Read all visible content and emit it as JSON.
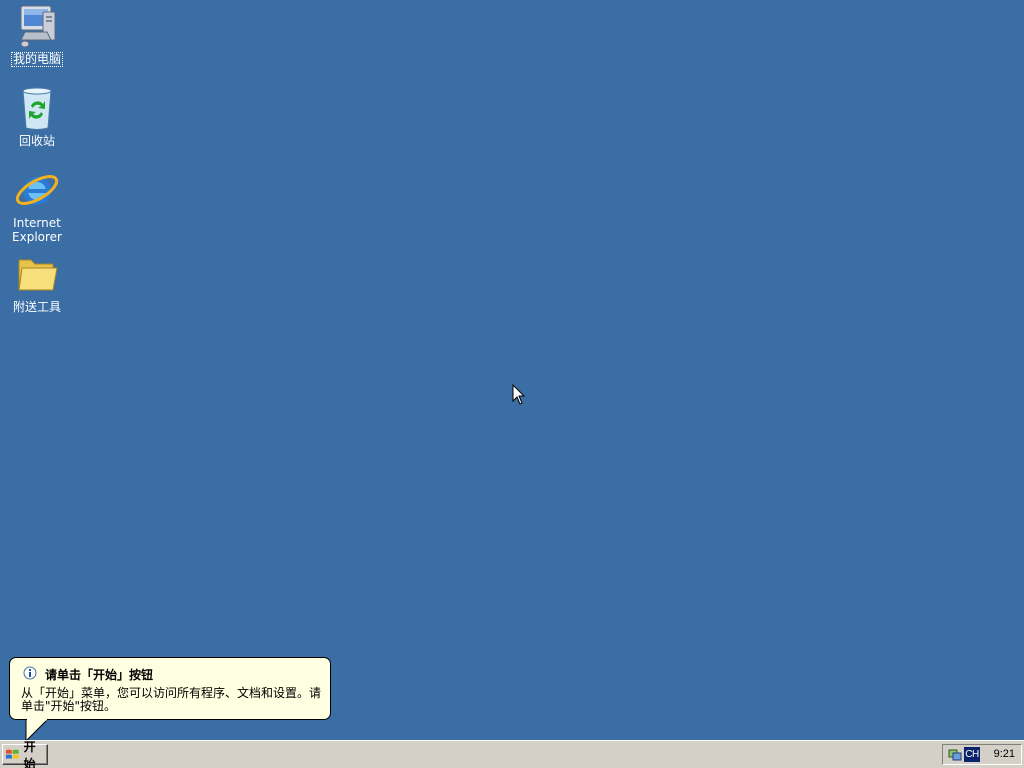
{
  "desktop": {
    "icons": [
      {
        "label": "我的电脑",
        "icon": "my-computer-icon"
      },
      {
        "label": "回收站",
        "icon": "recycle-bin-icon"
      },
      {
        "label_line1": "Internet",
        "label_line2": "Explorer",
        "icon": "internet-explorer-icon"
      },
      {
        "label": "附送工具",
        "icon": "folder-icon"
      }
    ],
    "background_color": "#3a6ea5"
  },
  "balloon": {
    "title": "请单击「开始」按钮",
    "text": "从「开始」菜单，您可以访问所有程序、文档和设置。请单击\"开始\"按钮。",
    "icon": "info-icon",
    "background_color": "#ffffe1"
  },
  "taskbar": {
    "start_label": "开始",
    "tray": {
      "language": "CH",
      "time": "9:21",
      "icons": [
        "network-icon"
      ]
    }
  }
}
